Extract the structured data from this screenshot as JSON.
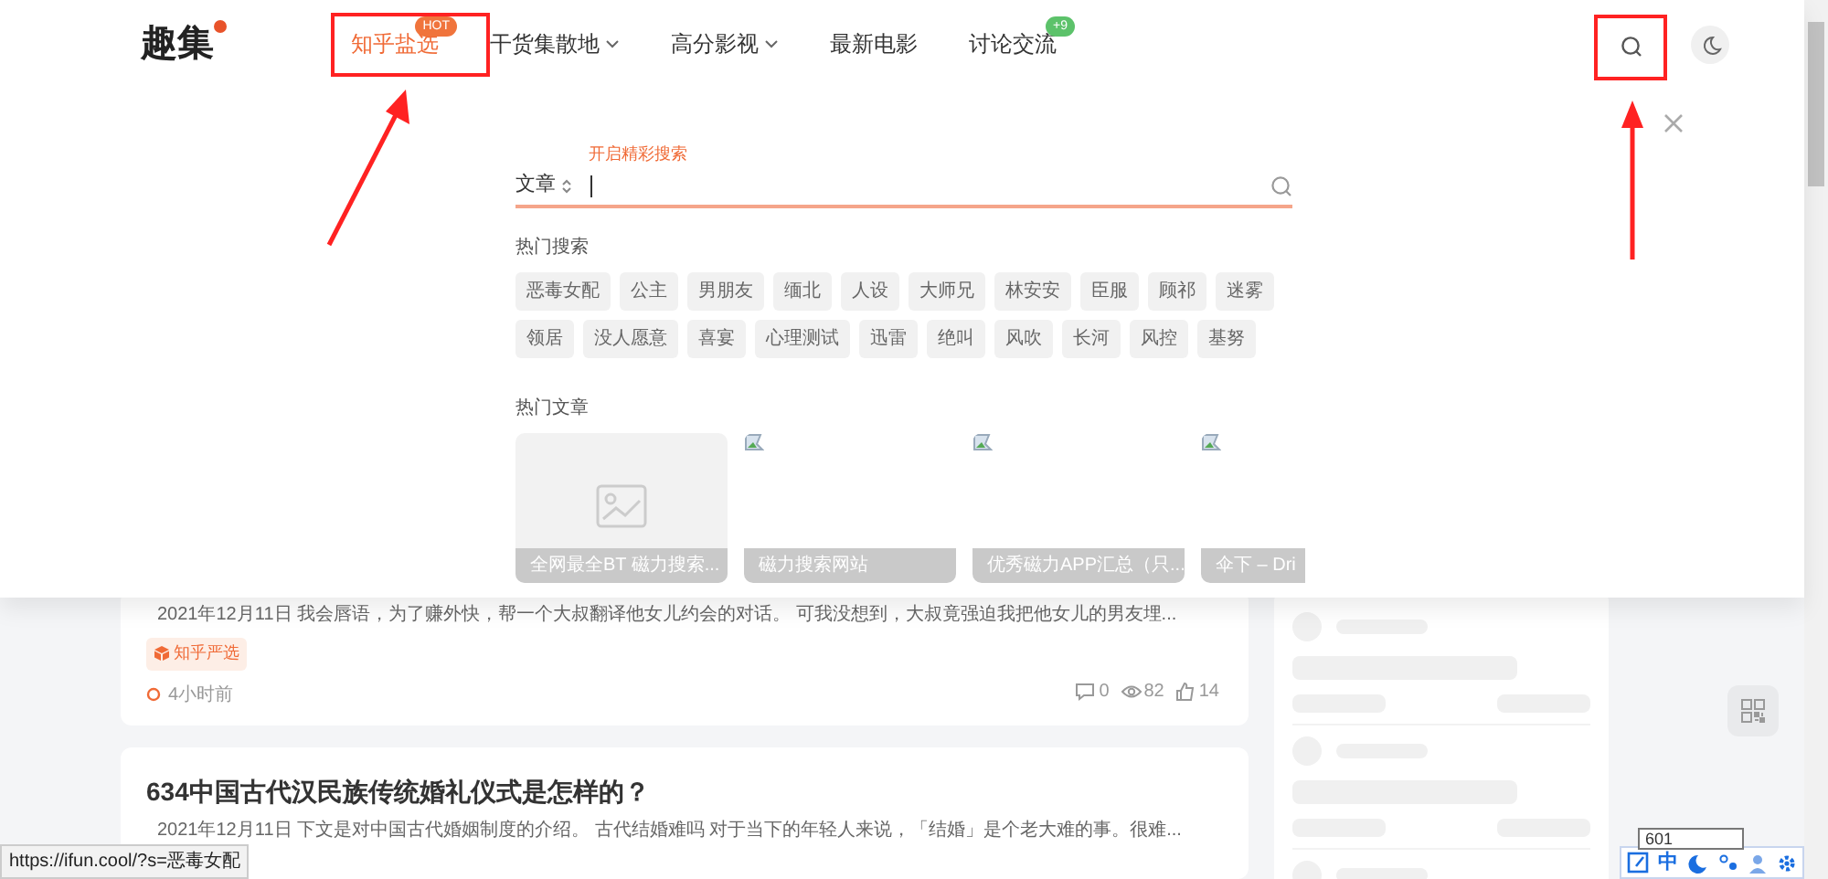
{
  "site": {
    "logo": "趣集"
  },
  "nav": [
    {
      "label": "知乎盐选",
      "selected": true,
      "dropdown": false,
      "badge": "HOT",
      "color": "#f0743c"
    },
    {
      "label": "干货集散地",
      "selected": false,
      "dropdown": true
    },
    {
      "label": "高分影视",
      "selected": false,
      "dropdown": true
    },
    {
      "label": "最新电影",
      "selected": false,
      "dropdown": false
    },
    {
      "label": "讨论交流",
      "selected": false,
      "dropdown": false,
      "badge": "+9",
      "color": "#5cc26a"
    }
  ],
  "search": {
    "label": "开启精彩搜索",
    "scope": "文章"
  },
  "hot_searches": {
    "title": "热门搜索",
    "tags": [
      "恶毒女配",
      "公主",
      "男朋友",
      "缅北",
      "人设",
      "大师兄",
      "林安安",
      "臣服",
      "顾祁",
      "迷雾",
      "领居",
      "没人愿意",
      "喜宴",
      "心理测试",
      "迅雷",
      "绝叫",
      "风吹",
      "长河",
      "风控",
      "基努"
    ]
  },
  "hot_articles": {
    "title": "热门文章",
    "items": [
      {
        "kind": "placeholder",
        "caption": "全网最全BT 磁力搜索..."
      },
      {
        "kind": "broken",
        "caption": "磁力搜索网站"
      },
      {
        "kind": "broken",
        "caption": "优秀磁力APP汇总（只..."
      },
      {
        "kind": "broken",
        "caption": "伞下 – Dri"
      }
    ]
  },
  "posts": [
    {
      "excerpt": "2021年12月11日 我会唇语，为了赚外快，帮一个大叔翻译他女儿约会的对话。 可我没想到，大叔竟强迫我把他女儿的男友埋...",
      "tag": "知乎严选",
      "time": "4小时前",
      "comments": "0",
      "views": "82",
      "likes": "14"
    },
    {
      "title": "634中国古代汉民族传统婚礼仪式是怎样的？",
      "excerpt": "2021年12月11日 下文是对中国古代婚姻制度的介绍。 古代结婚难吗 对于当下的年轻人来说，「结婚」是个老大难的事。很难..."
    }
  ],
  "status_bar": {
    "url": "https://ifun.cool/?s=恶毒女配"
  },
  "ime": {
    "tooltip": "601",
    "mode": "中"
  }
}
